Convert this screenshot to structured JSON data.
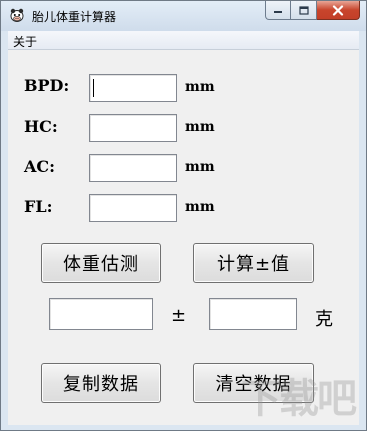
{
  "window": {
    "title": "胎儿体重计算器",
    "icon": "cow-app-icon",
    "controls": [
      "minimize-icon",
      "maximize-icon",
      "close-icon"
    ]
  },
  "menu": {
    "items": [
      {
        "label": "关于"
      }
    ]
  },
  "measurements": [
    {
      "label": "BPD:",
      "value": "",
      "unit": "mm"
    },
    {
      "label": "HC:",
      "value": "",
      "unit": "mm"
    },
    {
      "label": "AC:",
      "value": "",
      "unit": "mm"
    },
    {
      "label": "FL:",
      "value": "",
      "unit": "mm"
    }
  ],
  "buttons": {
    "estimate": "体重估测",
    "calc_pm": "计算±值",
    "copy": "复制数据",
    "clear": "清空数据"
  },
  "result": {
    "weight_value": "",
    "plusminus_symbol": "±",
    "tolerance_value": "",
    "unit": "克"
  },
  "watermark": "下载吧"
}
